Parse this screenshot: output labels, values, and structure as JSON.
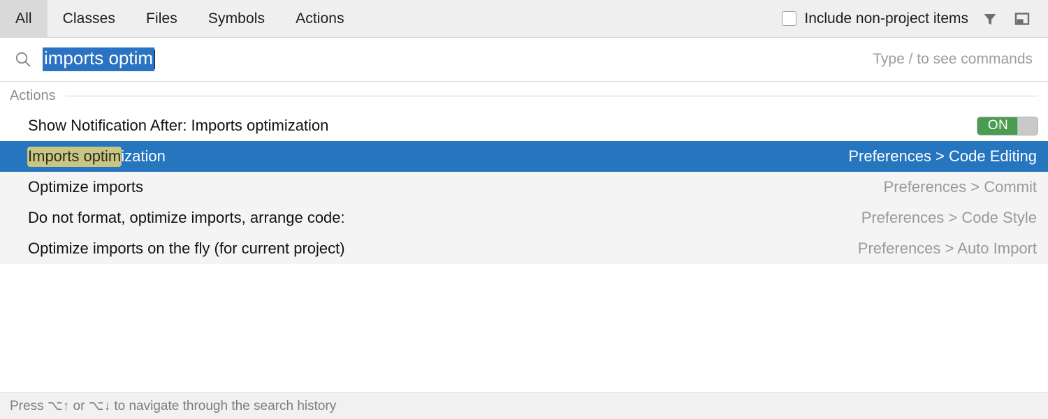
{
  "header": {
    "tabs": [
      {
        "label": "All",
        "active": true
      },
      {
        "label": "Classes",
        "active": false
      },
      {
        "label": "Files",
        "active": false
      },
      {
        "label": "Symbols",
        "active": false
      },
      {
        "label": "Actions",
        "active": false
      }
    ],
    "include_non_project": {
      "label": "Include non-project items",
      "checked": false
    },
    "filter_icon": "filter-funnel-icon",
    "preview_panel_icon": "preview-panel-icon"
  },
  "search": {
    "icon": "search-icon",
    "value": "imports optim",
    "selected": true,
    "hint": "Type / to see commands"
  },
  "results": {
    "group_title": "Actions",
    "rows": [
      {
        "label": "Show Notification After: Imports optimization",
        "location": "",
        "toggle": "ON",
        "selected": false,
        "stripe": "white"
      },
      {
        "label_match": "Imports optim",
        "label_rest": "ization",
        "location": "Preferences > Code Editing",
        "toggle": "",
        "selected": true,
        "stripe": "selected"
      },
      {
        "label": "Optimize imports",
        "location": "Preferences > Commit",
        "toggle": "",
        "selected": false,
        "stripe": "alt"
      },
      {
        "label": "Do not format, optimize imports, arrange code:",
        "location": "Preferences > Code Style",
        "toggle": "",
        "selected": false,
        "stripe": "alt"
      },
      {
        "label": "Optimize imports on the fly (for current project)",
        "location": "Preferences > Auto Import",
        "toggle": "",
        "selected": false,
        "stripe": "alt"
      }
    ]
  },
  "footer": {
    "hint": "Press ⌥↑ or ⌥↓ to navigate through the search history"
  },
  "colors": {
    "selection_blue": "#2675bf",
    "match_highlight": "#c9c583",
    "toggle_on_green": "#4a9c52",
    "header_bg": "#efefef",
    "alt_row": "#f4f4f4"
  }
}
